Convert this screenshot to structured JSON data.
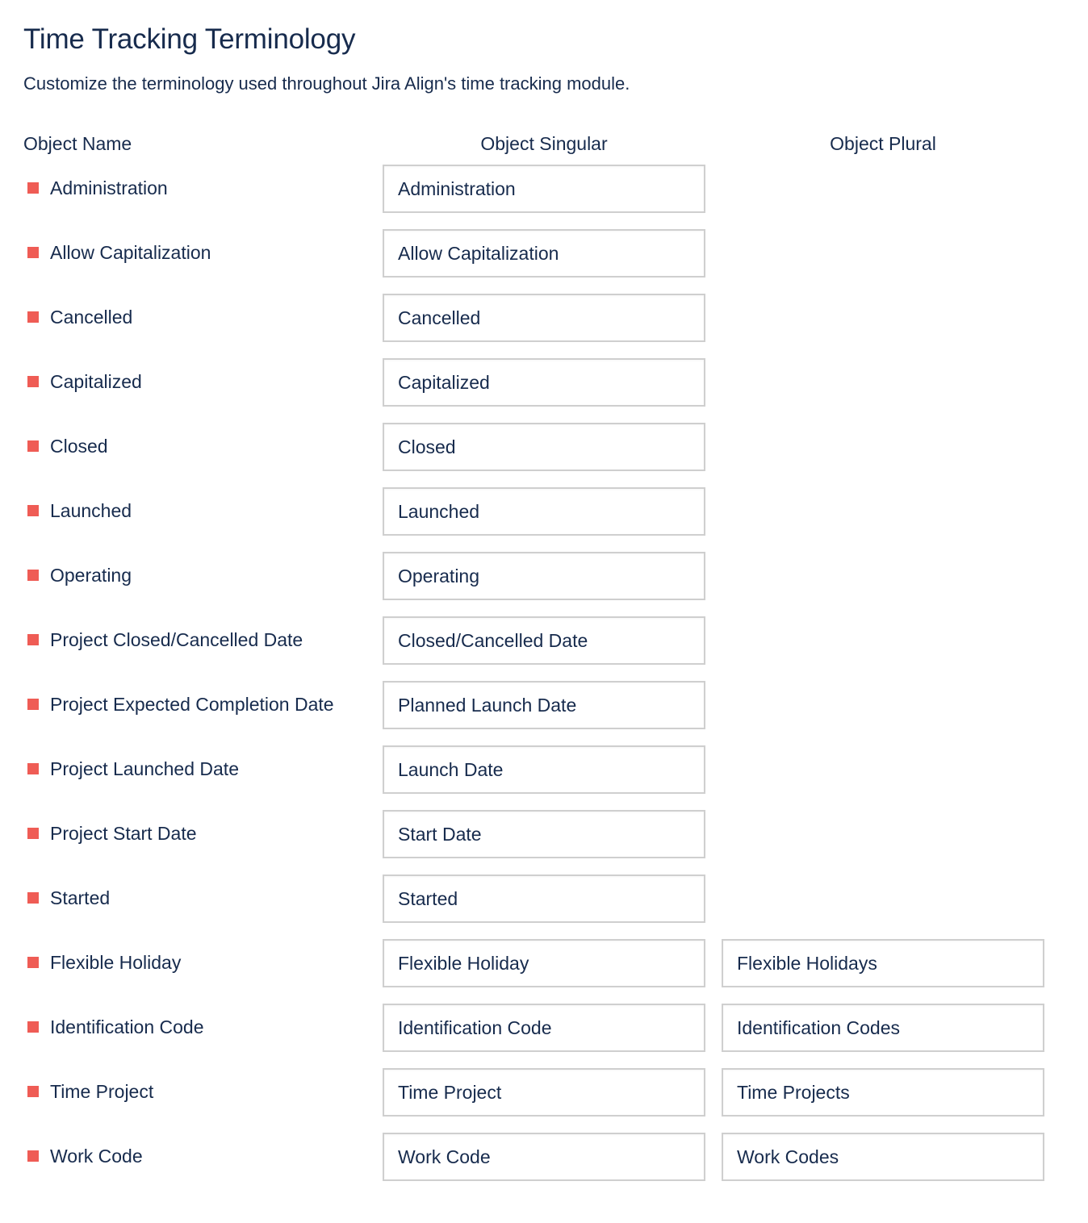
{
  "header": {
    "title": "Time Tracking Terminology",
    "description": "Customize the terminology used throughout Jira Align's time tracking module."
  },
  "columns": {
    "name": "Object Name",
    "singular": "Object Singular",
    "plural": "Object Plural"
  },
  "colors": {
    "bullet": "#ef5c55",
    "text": "#172b4d",
    "input_border": "#cfcfcf"
  },
  "rows": [
    {
      "name": "Administration",
      "singular": "Administration",
      "plural": null
    },
    {
      "name": "Allow Capitalization",
      "singular": "Allow Capitalization",
      "plural": null
    },
    {
      "name": "Cancelled",
      "singular": "Cancelled",
      "plural": null
    },
    {
      "name": "Capitalized",
      "singular": "Capitalized",
      "plural": null
    },
    {
      "name": "Closed",
      "singular": "Closed",
      "plural": null
    },
    {
      "name": "Launched",
      "singular": "Launched",
      "plural": null
    },
    {
      "name": "Operating",
      "singular": "Operating",
      "plural": null
    },
    {
      "name": "Project Closed/Cancelled Date",
      "singular": "Closed/Cancelled Date",
      "plural": null
    },
    {
      "name": "Project Expected Completion Date",
      "singular": "Planned Launch Date",
      "plural": null
    },
    {
      "name": "Project Launched Date",
      "singular": "Launch Date",
      "plural": null
    },
    {
      "name": "Project Start Date",
      "singular": "Start Date",
      "plural": null
    },
    {
      "name": "Started",
      "singular": "Started",
      "plural": null
    },
    {
      "name": "Flexible Holiday",
      "singular": "Flexible Holiday",
      "plural": "Flexible Holidays"
    },
    {
      "name": "Identification Code",
      "singular": "Identification Code",
      "plural": "Identification Codes"
    },
    {
      "name": "Time Project",
      "singular": "Time Project",
      "plural": "Time Projects"
    },
    {
      "name": "Work Code",
      "singular": "Work Code",
      "plural": "Work Codes"
    }
  ]
}
